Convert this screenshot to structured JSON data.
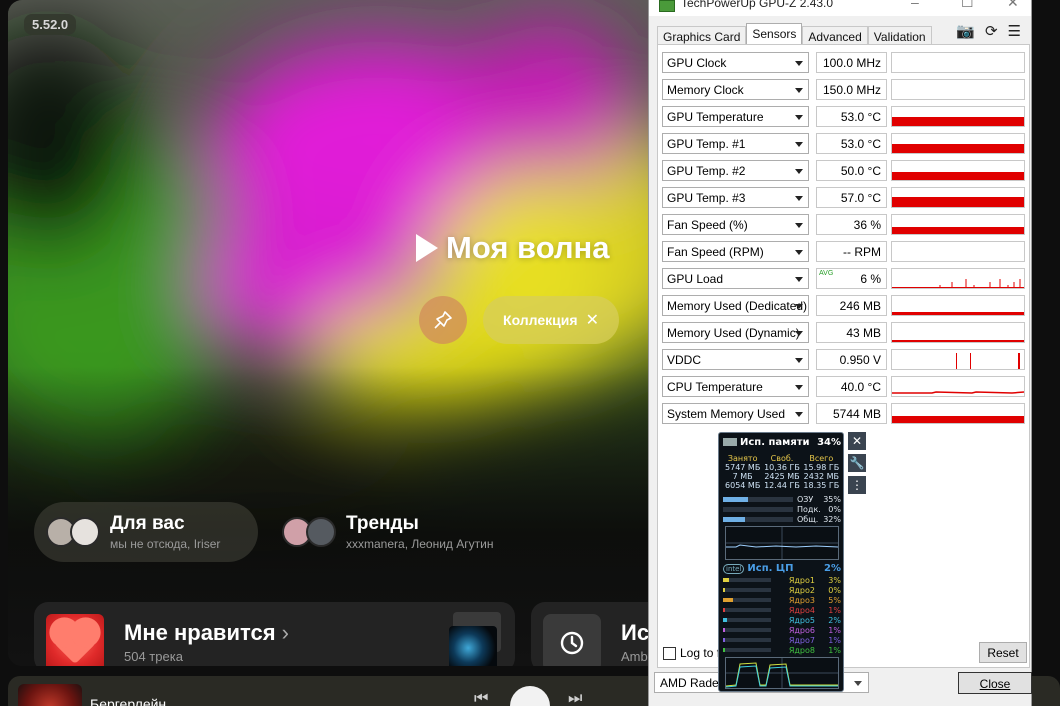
{
  "music": {
    "version": "5.52.0",
    "wave_title": "Моя волна",
    "collection_label": "Коллекция",
    "chips": [
      {
        "title": "Для вас",
        "subtitle": "мы не отсюда, Iriser"
      },
      {
        "title": "Тренды",
        "subtitle": "xxxmanera, Леонид Агутин"
      }
    ],
    "likes_card": {
      "title": "Мне нравится",
      "chevron": "›",
      "subtitle": "504 трека"
    },
    "history_card": {
      "title": "Ист",
      "subtitle": "Amby"
    },
    "player": {
      "track": "Бергерлейн"
    },
    "colors": {
      "magenta": "#e11ed8",
      "yellow": "#e8e020",
      "green": "#4aa020"
    }
  },
  "gpuz": {
    "title": "TechPowerUp GPU-Z 2.43.0",
    "tabs": [
      "Graphics Card",
      "Sensors",
      "Advanced",
      "Validation"
    ],
    "active_tab": "Sensors",
    "sensors": [
      {
        "name": "GPU Clock",
        "value": "100.0 MHz",
        "graph": "none",
        "level": 0
      },
      {
        "name": "Memory Clock",
        "value": "150.0 MHz",
        "graph": "none",
        "level": 0
      },
      {
        "name": "GPU Temperature",
        "value": "53.0 °C",
        "graph": "bar",
        "level": 0.45
      },
      {
        "name": "GPU Temp. #1",
        "value": "53.0 °C",
        "graph": "bar",
        "level": 0.45
      },
      {
        "name": "GPU Temp. #2",
        "value": "50.0 °C",
        "graph": "bar",
        "level": 0.4
      },
      {
        "name": "GPU Temp. #3",
        "value": "57.0 °C",
        "graph": "bar",
        "level": 0.5
      },
      {
        "name": "Fan Speed (%)",
        "value": "36 %",
        "graph": "bar",
        "level": 0.35
      },
      {
        "name": "Fan Speed (RPM)",
        "value": "-- RPM",
        "graph": "none",
        "level": 0
      },
      {
        "name": "GPU Load",
        "value": "6 %",
        "graph": "spikes",
        "level": 0.06
      },
      {
        "name": "Memory Used (Dedicated)",
        "value": "246 MB",
        "graph": "bar",
        "level": 0.15
      },
      {
        "name": "Memory Used (Dynamic)",
        "value": "43 MB",
        "graph": "bar",
        "level": 0.05
      },
      {
        "name": "VDDC",
        "value": "0.950 V",
        "graph": "vspikes",
        "level": 0.1
      },
      {
        "name": "CPU Temperature",
        "value": "40.0 °C",
        "graph": "line",
        "level": 0.12
      },
      {
        "name": "System Memory Used",
        "value": "5744 MB",
        "graph": "bar",
        "level": 0.35
      }
    ],
    "avg_badge": "AVG",
    "log_label": "Log to file",
    "reset_label": "Reset",
    "gpu_select": "AMD Radeon",
    "close_label": "Close",
    "graph_color": "#e00000"
  },
  "gadget": {
    "mem_title": "Исп. памяти",
    "mem_pct": "34%",
    "headers": [
      "Занято",
      "Своб.",
      "Всего"
    ],
    "rows": [
      [
        "5747 МБ",
        "10,36 ГБ",
        "15.98 ГБ"
      ],
      [
        "7 МБ",
        "2425 МБ",
        "2432 МБ"
      ],
      [
        "6054 МБ",
        "12.44 ГБ",
        "18.35 ГБ"
      ]
    ],
    "bars": [
      {
        "label": "ОЗУ",
        "value": "35%",
        "fraction": 0.35
      },
      {
        "label": "Подк.",
        "value": "0%",
        "fraction": 0.0
      },
      {
        "label": "Общ.",
        "value": "32%",
        "fraction": 0.32
      }
    ],
    "intel_badge": "intel",
    "cpu_title": "Исп. ЦП",
    "cpu_pct": "2%",
    "cores": [
      {
        "label": "Ядро1",
        "value": "3%",
        "color": "#e0d040",
        "fraction": 0.03
      },
      {
        "label": "Ядро2",
        "value": "0%",
        "color": "#e0d040",
        "fraction": 0.0
      },
      {
        "label": "Ядро3",
        "value": "5%",
        "color": "#e0a030",
        "fraction": 0.05
      },
      {
        "label": "Ядро4",
        "value": "1%",
        "color": "#e04040",
        "fraction": 0.01
      },
      {
        "label": "Ядро5",
        "value": "2%",
        "color": "#40c0e0",
        "fraction": 0.02
      },
      {
        "label": "Ядро6",
        "value": "1%",
        "color": "#c060e0",
        "fraction": 0.01
      },
      {
        "label": "Ядро7",
        "value": "1%",
        "color": "#8060e0",
        "fraction": 0.01
      },
      {
        "label": "Ядро8",
        "value": "1%",
        "color": "#40c040",
        "fraction": 0.01
      }
    ]
  }
}
